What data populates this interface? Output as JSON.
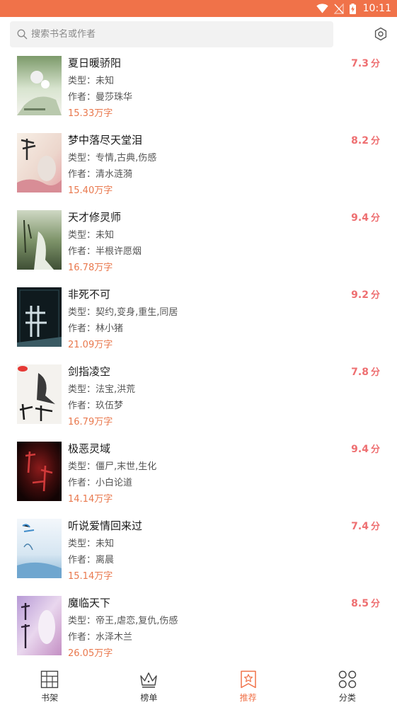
{
  "status_bar": {
    "time": "10:11"
  },
  "search": {
    "placeholder": "搜索书名或作者"
  },
  "labels": {
    "type_prefix": "类型：",
    "author_prefix": "作者：",
    "score_unit": "分"
  },
  "colors": {
    "accent": "#f07249",
    "score": "#ee6f71",
    "words": "#e9784d"
  },
  "books": [
    {
      "title": "夏日暖骄阳",
      "type": "未知",
      "author": "曼莎珠华",
      "words": "15.33万字",
      "score": "7.3"
    },
    {
      "title": "梦中落尽天堂泪",
      "type": "专情,古典,伤感",
      "author": "清水涟漪",
      "words": "15.40万字",
      "score": "8.2"
    },
    {
      "title": "天才修灵师",
      "type": "未知",
      "author": "半根许愿烟",
      "words": "16.78万字",
      "score": "9.4"
    },
    {
      "title": "非死不可",
      "type": "契约,变身,重生,同居",
      "author": "林小猪",
      "words": "21.09万字",
      "score": "9.2"
    },
    {
      "title": "剑指凌空",
      "type": "法宝,洪荒",
      "author": "玖伍梦",
      "words": "16.79万字",
      "score": "7.8"
    },
    {
      "title": "极恶灵域",
      "type": "僵尸,末世,生化",
      "author": "小白论道",
      "words": "14.14万字",
      "score": "9.4"
    },
    {
      "title": "听说爱情回来过",
      "type": "未知",
      "author": "离晨",
      "words": "15.14万字",
      "score": "7.4"
    },
    {
      "title": "魔临天下",
      "type": "帝王,虐恋,复仇,伤感",
      "author": "水泽木兰",
      "words": "26.05万字",
      "score": "8.5"
    }
  ],
  "nav": {
    "items": [
      {
        "label": "书架",
        "icon": "bookshelf-icon"
      },
      {
        "label": "榜单",
        "icon": "crown-icon"
      },
      {
        "label": "推荐",
        "icon": "bookmark-star-icon",
        "active": true
      },
      {
        "label": "分类",
        "icon": "category-grid-icon"
      }
    ]
  }
}
